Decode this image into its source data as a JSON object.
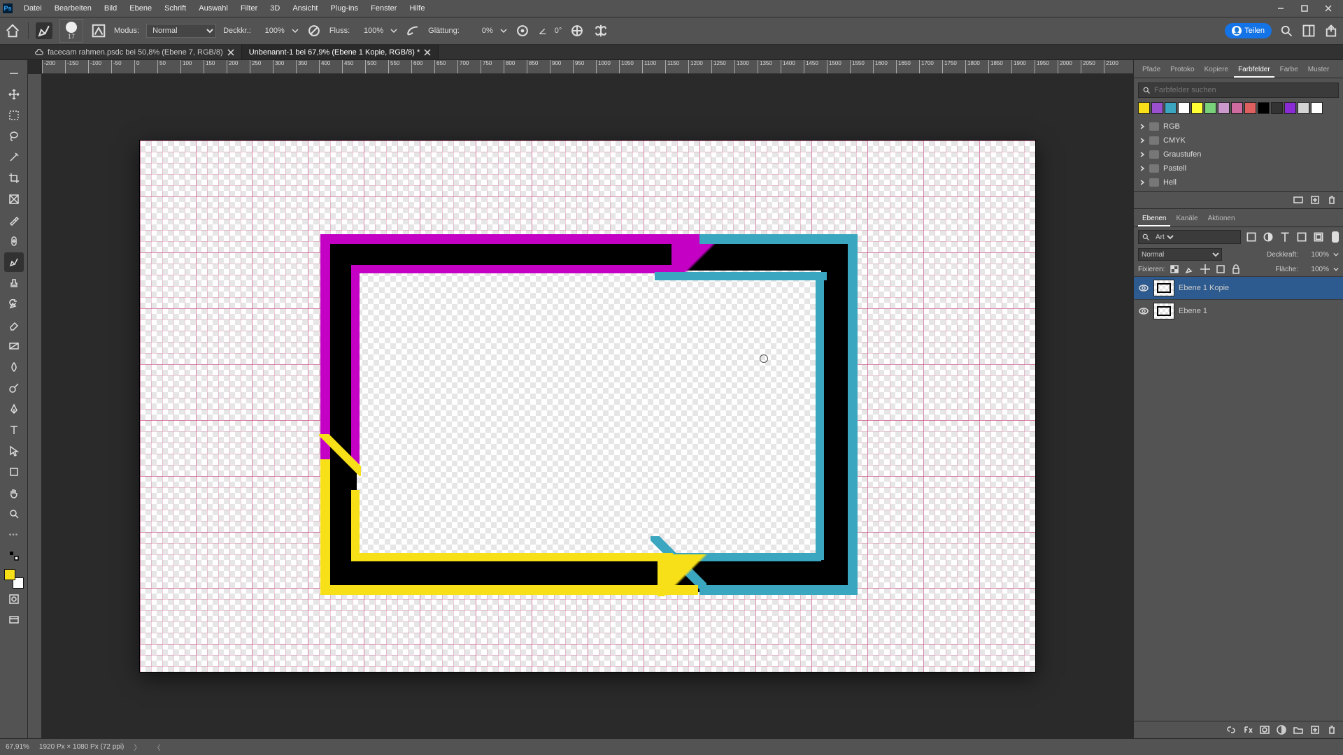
{
  "menu": [
    "Datei",
    "Bearbeiten",
    "Bild",
    "Ebene",
    "Schrift",
    "Auswahl",
    "Filter",
    "3D",
    "Ansicht",
    "Plug-ins",
    "Fenster",
    "Hilfe"
  ],
  "options": {
    "brush_size": "17",
    "mode_label": "Modus:",
    "mode_value": "Normal",
    "opacity_label": "Deckkr.:",
    "opacity_value": "100%",
    "flow_label": "Fluss:",
    "flow_value": "100%",
    "smoothing_label": "Glättung:",
    "smoothing_value": "0%",
    "angle_icon_value": "0°",
    "share_label": "Teilen"
  },
  "tabs": [
    {
      "label": "facecam rahmen.psdc bei 50,8% (Ebene 7, RGB/8)",
      "cloud": true,
      "active": false
    },
    {
      "label": "Unbenannt-1 bei 67,9% (Ebene 1 Kopie, RGB/8) *",
      "cloud": false,
      "active": true
    }
  ],
  "ruler_ticks": [
    "-200",
    "-150",
    "-100",
    "-50",
    "0",
    "50",
    "100",
    "150",
    "200",
    "250",
    "300",
    "350",
    "400",
    "450",
    "500",
    "550",
    "600",
    "650",
    "700",
    "750",
    "800",
    "850",
    "900",
    "950",
    "1000",
    "1050",
    "1100",
    "1150",
    "1200",
    "1250",
    "1300",
    "1350",
    "1400",
    "1450",
    "1500",
    "1550",
    "1600",
    "1650",
    "1700",
    "1750",
    "1800",
    "1850",
    "1900",
    "1950",
    "2000",
    "2050",
    "2100"
  ],
  "right_tabs_top": [
    "Pfade",
    "Protoko",
    "Kopiere",
    "Farbfelder",
    "Farbe",
    "Muster"
  ],
  "right_tabs_top_active": 3,
  "swatch_search_placeholder": "Farbfelder suchen",
  "swatch_colors": [
    "#f7e017",
    "#9a4fcf",
    "#3aa6bf",
    "#ffffff",
    "#ffff33",
    "#79d279",
    "#cc99cc",
    "#cf6b9f",
    "#e06060",
    "#000000",
    "#333333",
    "#8a2bd6",
    "#d4d4d4",
    "#ffffff"
  ],
  "swatch_folders": [
    "RGB",
    "CMYK",
    "Graustufen",
    "Pastell",
    "Hell"
  ],
  "right_tabs_mid": [
    "Ebenen",
    "Kanäle",
    "Aktionen"
  ],
  "right_tabs_mid_active": 0,
  "layers": {
    "filter_type": "Art",
    "blend_mode": "Normal",
    "opacity_label": "Deckkraft:",
    "opacity_value": "100%",
    "lock_label": "Fixieren:",
    "fill_label": "Fläche:",
    "fill_value": "100%",
    "items": [
      {
        "name": "Ebene 1 Kopie",
        "selected": true
      },
      {
        "name": "Ebene 1",
        "selected": false
      }
    ]
  },
  "status": {
    "zoom": "67,91%",
    "docinfo": "1920 Px × 1080 Px (72 ppi)"
  }
}
